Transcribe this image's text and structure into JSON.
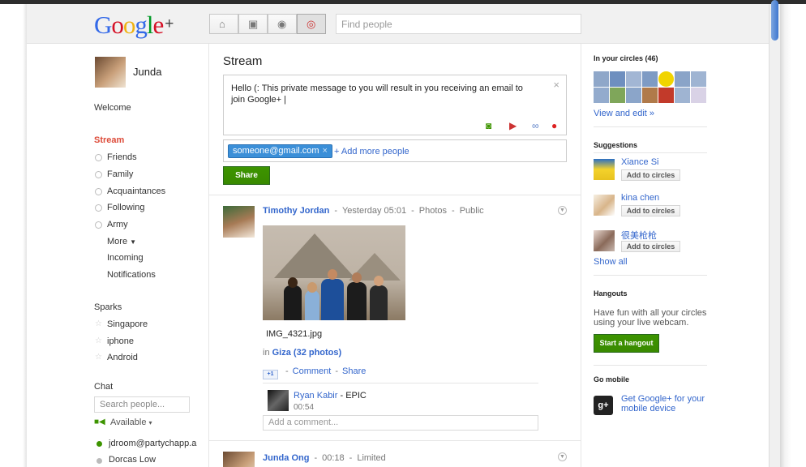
{
  "header": {
    "logo": {
      "G": "G",
      "o1": "o",
      "o2": "o",
      "g": "g",
      "l": "l",
      "e": "e",
      "plus": "+"
    },
    "nav_icons": [
      "home-icon",
      "photos-icon",
      "profile-icon",
      "circles-icon"
    ],
    "search_placeholder": "Find people"
  },
  "left_nav": {
    "user_name": "Junda",
    "welcome": "Welcome",
    "stream": "Stream",
    "circles": [
      "Friends",
      "Family",
      "Acquaintances",
      "Following",
      "Army"
    ],
    "more": "More",
    "incoming": "Incoming",
    "notifications": "Notifications",
    "sparks_title": "Sparks",
    "sparks": [
      "Singapore",
      "iphone",
      "Android"
    ],
    "chat_title": "Chat",
    "chat_search_placeholder": "Search people...",
    "availability": "Available",
    "contacts": [
      "jdroom@partychapp.a",
      "Dorcas Low"
    ]
  },
  "main": {
    "title": "Stream",
    "composer_text": "Hello (: This private message to you will result in you receiving an email to join Google+ |",
    "recipient_chip": "someone@gmail.com",
    "chip_remove": "×",
    "add_more": "+ Add more people",
    "share_button": "Share",
    "post1": {
      "author": "Timothy Jordan",
      "time": "Yesterday 05:01",
      "category": "Photos",
      "visibility": "Public",
      "filename": "IMG_4321.jpg",
      "in_label": "in",
      "album": "Giza (32 photos)",
      "plusone": "+1",
      "comment_link": "Comment",
      "share_link": "Share",
      "comment": {
        "author": "Ryan Kabir",
        "text": "- EPIC",
        "time": "00:54"
      },
      "add_comment_placeholder": "Add a comment..."
    },
    "post2": {
      "author": "Junda Ong",
      "time": "00:18",
      "visibility": "Limited"
    }
  },
  "right": {
    "circles_title": "In your circles (46)",
    "view_edit": "View and edit »",
    "suggestions_title": "Suggestions",
    "suggestions": [
      {
        "name": "Xiance Si",
        "button": "Add to circles"
      },
      {
        "name": "kina chen",
        "button": "Add to circles"
      },
      {
        "name": "很美枪枪",
        "button": "Add to circles"
      }
    ],
    "show_all": "Show all",
    "hangouts_title": "Hangouts",
    "hangouts_text": "Have fun with all your circles using your live webcam.",
    "hangout_button": "Start a hangout",
    "mobile_title": "Go mobile",
    "mobile_link": "Get Google+ for your mobile device",
    "mobile_icon_text": "g+"
  },
  "colors": {
    "accent_red": "#dd4b39",
    "link_blue": "#3366cc",
    "share_green": "#3d9400",
    "chip_blue": "#3b8fd8"
  }
}
